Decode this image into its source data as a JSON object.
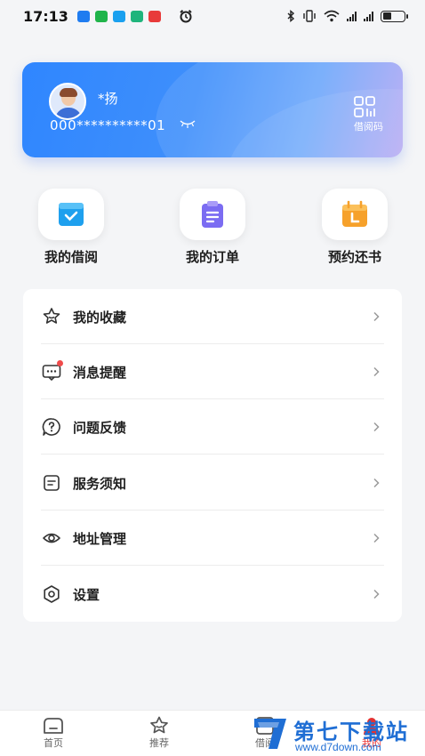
{
  "status_bar": {
    "time": "17:13",
    "app_icons": [
      {
        "name": "app-icon-blue",
        "color": "#1f7cf0"
      },
      {
        "name": "wechat-icon",
        "color": "#20b44a"
      },
      {
        "name": "app-icon-chat",
        "color": "#1aa0ef"
      },
      {
        "name": "app-icon-green",
        "color": "#1fb47c"
      },
      {
        "name": "app-icon-red",
        "color": "#e83a3a"
      }
    ]
  },
  "card": {
    "user_name": "*扬",
    "card_number": "000**********01",
    "qr_label": "借阅码"
  },
  "quick_actions": [
    {
      "label": "我的借阅",
      "icon": "borrow-icon",
      "color": "#1ea0ee"
    },
    {
      "label": "我的订单",
      "icon": "order-icon",
      "color": "#7b6cf2"
    },
    {
      "label": "预约还书",
      "icon": "return-icon",
      "color": "#f6a12b"
    }
  ],
  "menu": [
    {
      "label": "我的收藏",
      "icon": "favorite-icon"
    },
    {
      "label": "消息提醒",
      "icon": "message-icon",
      "badge": true
    },
    {
      "label": "问题反馈",
      "icon": "feedback-icon"
    },
    {
      "label": "服务须知",
      "icon": "notice-icon"
    },
    {
      "label": "地址管理",
      "icon": "address-icon"
    },
    {
      "label": "设置",
      "icon": "settings-icon"
    }
  ],
  "tabbar": [
    {
      "label": "首页",
      "icon": "home-icon"
    },
    {
      "label": "推荐",
      "icon": "recommend-icon"
    },
    {
      "label": "借阅",
      "icon": "borrow-tab-icon"
    },
    {
      "label": "我的",
      "icon": "profile-icon",
      "active": true
    }
  ],
  "watermark": {
    "title": "第七下载站",
    "url": "www.d7down.com"
  },
  "colors": {
    "accent": "#2f86ff",
    "active_tab": "#e33333",
    "badge": "#f04b4b"
  }
}
